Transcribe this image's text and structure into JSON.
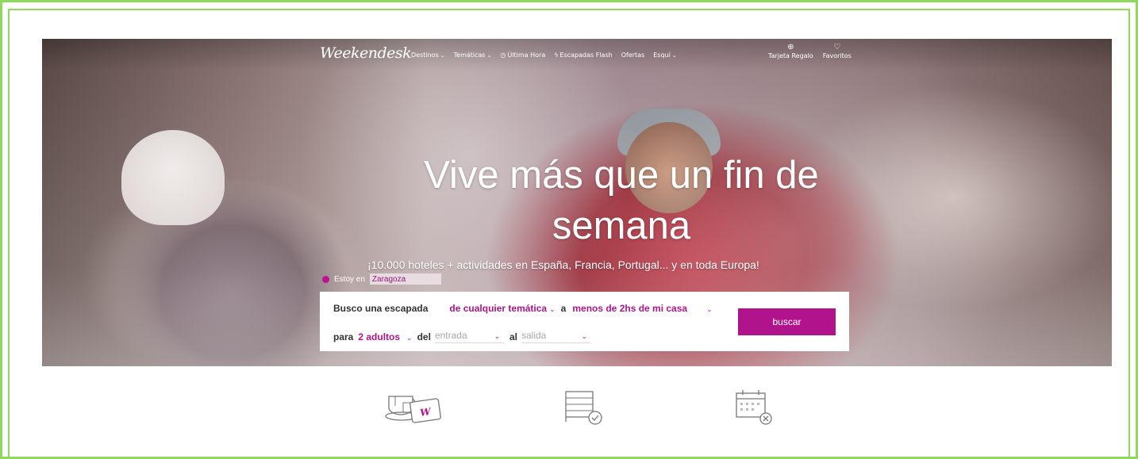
{
  "header": {
    "logo": "Weekendesk",
    "nav": [
      {
        "label": "Destinos",
        "chevron": true
      },
      {
        "label": "Temáticas",
        "chevron": true
      },
      {
        "label": "Última Hora",
        "icon": "clock-icon",
        "chevron": false
      },
      {
        "label": "Escapadas Flash",
        "icon": "lightning-icon",
        "chevron": false
      },
      {
        "label": "Ofertas",
        "chevron": false
      },
      {
        "label": "Esquí",
        "chevron": true
      }
    ],
    "right": [
      {
        "label": "Tarjeta Regalo",
        "icon": "gift-icon"
      },
      {
        "label": "Favoritos",
        "icon": "heart-icon"
      }
    ]
  },
  "hero": {
    "title_line1": "Vive más que un fin de",
    "title_line2": "semana",
    "subtitle": "¡10.000 hoteles + actividades en España, Francia, Portugal... y en toda Europa!"
  },
  "location": {
    "label": "Estoy en",
    "value": "Zaragoza"
  },
  "search": {
    "busco_label": "Busco una escapada",
    "tematica": "de cualquier temática",
    "a_label": "a",
    "distancia": "menos de 2hs de mi casa",
    "para_label": "para",
    "adultos": "2 adultos",
    "del_label": "del",
    "entrada_placeholder": "entrada",
    "al_label": "al",
    "salida_placeholder": "salida",
    "button": "buscar"
  },
  "features": [
    {
      "icon": "gift-voucher-icon"
    },
    {
      "icon": "bed-check-icon"
    },
    {
      "icon": "calendar-cancel-icon"
    }
  ],
  "colors": {
    "accent": "#b0138b",
    "frame": "#8ed85e"
  }
}
